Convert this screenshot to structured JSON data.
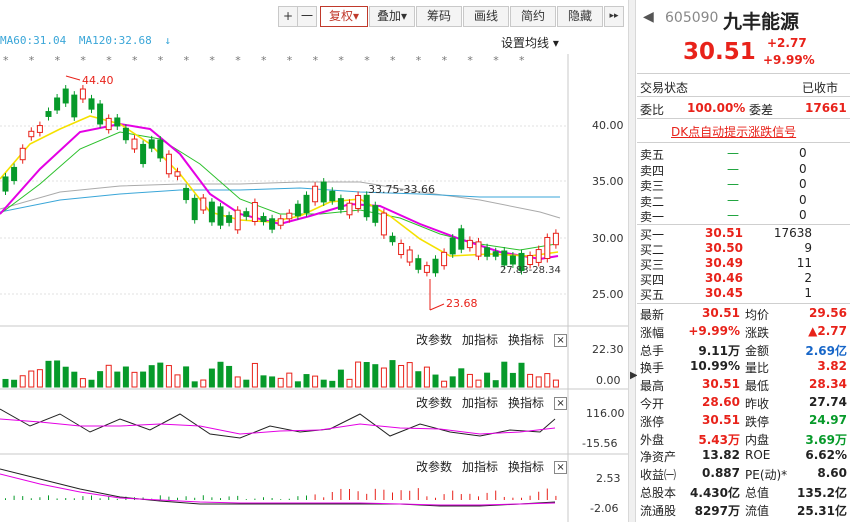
{
  "toolbar": {
    "plus": "+",
    "minus": "一",
    "fuquan": "复权",
    "diejia": "叠加",
    "choumа": "筹码",
    "huaxian": "画线",
    "jianyue": "简约",
    "yincang": "隐藏",
    "arrows": "▸▸"
  },
  "ma_legend": {
    "ma60": "MA60:31.04",
    "ma120": "MA120:32.68",
    "arrow": "↓"
  },
  "settings_label": "设置均线 ▾",
  "price_axis": [
    "40.00",
    "35.00",
    "30.00",
    "25.00"
  ],
  "annotations": {
    "high": "44.40",
    "low": "23.68",
    "range": "33.75-33.66",
    "mid": "27.83-28.34"
  },
  "vol_axis": [
    "22.30",
    "0.00"
  ],
  "macd_axis": [
    "116.00",
    "-15.56"
  ],
  "kdj_axis": [
    "2.53",
    "-2.06"
  ],
  "panel_header": {
    "p1": "改参数",
    "p2": "加指标",
    "p3": "换指标",
    "close": "×"
  },
  "stock": {
    "code": "605090",
    "name": "九丰能源",
    "price": "30.51",
    "change": "+2.77",
    "pct": "+9.99%"
  },
  "status": {
    "label": "交易状态",
    "value": "已收市"
  },
  "weibi": {
    "label": "委比",
    "value": "100.00%",
    "label2": "委差",
    "value2": "17661"
  },
  "dk_link": "DK点自动提示涨跌信号",
  "sell": [
    {
      "label": "卖五",
      "price": "—",
      "vol": "0"
    },
    {
      "label": "卖四",
      "price": "—",
      "vol": "0"
    },
    {
      "label": "卖三",
      "price": "—",
      "vol": "0"
    },
    {
      "label": "卖二",
      "price": "—",
      "vol": "0"
    },
    {
      "label": "卖一",
      "price": "—",
      "vol": "0"
    }
  ],
  "buy": [
    {
      "label": "买一",
      "price": "30.51",
      "vol": "17638"
    },
    {
      "label": "买二",
      "price": "30.50",
      "vol": "9"
    },
    {
      "label": "买三",
      "price": "30.49",
      "vol": "11"
    },
    {
      "label": "买四",
      "price": "30.46",
      "vol": "2"
    },
    {
      "label": "买五",
      "price": "30.45",
      "vol": "1"
    }
  ],
  "quote": [
    {
      "l1": "最新",
      "v1": "30.51",
      "c1": "red",
      "l2": "均价",
      "v2": "29.56",
      "c2": "red"
    },
    {
      "l1": "涨幅",
      "v1": "+9.99%",
      "c1": "red",
      "l2": "涨跌",
      "v2": "▲2.77",
      "c2": "red"
    },
    {
      "l1": "总手",
      "v1": "9.11万",
      "c1": "",
      "l2": "金额",
      "v2": "2.69亿",
      "c2": "blue"
    },
    {
      "l1": "换手",
      "v1": "10.99%",
      "c1": "",
      "l2": "量比",
      "v2": "3.82",
      "c2": "red"
    },
    {
      "l1": "最高",
      "v1": "30.51",
      "c1": "red",
      "l2": "最低",
      "v2": "28.34",
      "c2": "red"
    },
    {
      "l1": "今开",
      "v1": "28.60",
      "c1": "red",
      "l2": "昨收",
      "v2": "27.74",
      "c2": ""
    },
    {
      "l1": "涨停",
      "v1": "30.51",
      "c1": "red",
      "l2": "跌停",
      "v2": "24.97",
      "c2": "green"
    },
    {
      "l1": "外盘",
      "v1": "5.43万",
      "c1": "red",
      "l2": "内盘",
      "v2": "3.69万",
      "c2": "green"
    },
    {
      "l1": "净资产",
      "v1": "13.82",
      "c1": "",
      "l2": "ROE",
      "v2": "6.62%",
      "c2": ""
    },
    {
      "l1": "收益㈠",
      "v1": "0.887",
      "c1": "",
      "l2": "PE(动)*",
      "v2": "8.60",
      "c2": ""
    },
    {
      "l1": "总股本",
      "v1": "4.430亿",
      "c1": "",
      "l2": "总值",
      "v2": "135.2亿",
      "c2": ""
    },
    {
      "l1": "流通股",
      "v1": "8297万",
      "c1": "",
      "l2": "流值",
      "v2": "25.31亿",
      "c2": ""
    }
  ],
  "colors": {
    "up": "#e8221a",
    "down": "#079a2a",
    "ma5": "#f5e100",
    "ma10": "#e400e4",
    "ma20": "#2bc02b",
    "ma60": "#3aa6d8",
    "ma120": "#999999"
  }
}
